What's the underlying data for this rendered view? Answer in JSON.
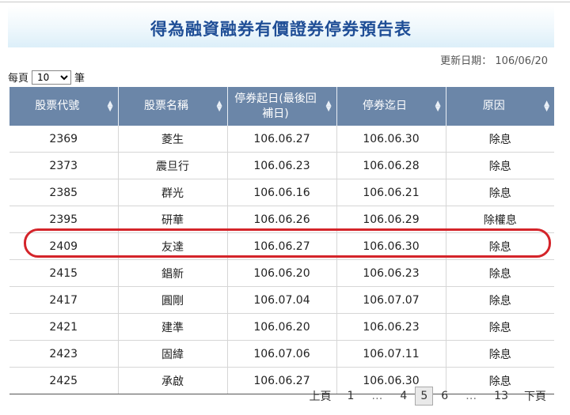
{
  "header": {
    "title": "得為融資融券有價證券停券預告表",
    "update_label": "更新日期：",
    "update_date": "106/06/20"
  },
  "per_page": {
    "prefix": "每頁",
    "value": "10",
    "suffix": "筆"
  },
  "table": {
    "columns": [
      "股票代號",
      "股票名稱",
      "停券起日(最後回補日)",
      "停券迄日",
      "原因"
    ],
    "rows": [
      [
        "2369",
        "菱生",
        "106.06.27",
        "106.06.30",
        "除息"
      ],
      [
        "2373",
        "震旦行",
        "106.06.23",
        "106.06.28",
        "除息"
      ],
      [
        "2385",
        "群光",
        "106.06.16",
        "106.06.21",
        "除息"
      ],
      [
        "2395",
        "研華",
        "106.06.26",
        "106.06.29",
        "除權息"
      ],
      [
        "2409",
        "友達",
        "106.06.27",
        "106.06.30",
        "除息"
      ],
      [
        "2415",
        "錩新",
        "106.06.20",
        "106.06.23",
        "除息"
      ],
      [
        "2417",
        "圓剛",
        "106.07.04",
        "106.07.07",
        "除息"
      ],
      [
        "2421",
        "建準",
        "106.06.20",
        "106.06.23",
        "除息"
      ],
      [
        "2423",
        "固緯",
        "106.07.06",
        "106.07.11",
        "除息"
      ],
      [
        "2425",
        "承啟",
        "106.06.27",
        "106.06.30",
        "除息"
      ]
    ],
    "highlighted_row": "2409"
  },
  "pager": {
    "prev": "上頁",
    "first": "1",
    "ellipsis": "…",
    "p4": "4",
    "current": "5",
    "p6": "6",
    "last": "13",
    "next": "下頁"
  },
  "colors": {
    "title": "#1f4e96",
    "header_bg": "#6b86a8",
    "highlight": "#d4242a"
  },
  "icons": [
    "sort-icon"
  ]
}
